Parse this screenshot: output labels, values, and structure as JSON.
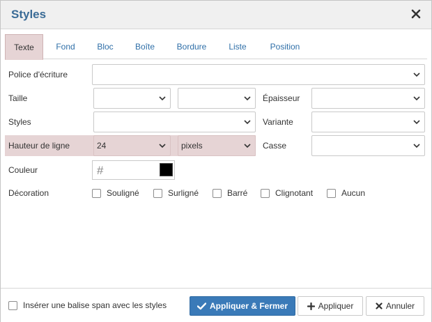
{
  "dialog": {
    "title": "Styles",
    "close_icon": "close-icon"
  },
  "tabs": [
    {
      "label": "Texte",
      "active": true
    },
    {
      "label": "Fond",
      "active": false
    },
    {
      "label": "Bloc",
      "active": false
    },
    {
      "label": "Boîte",
      "active": false
    },
    {
      "label": "Bordure",
      "active": false
    },
    {
      "label": "Liste",
      "active": false
    },
    {
      "label": "Position",
      "active": false
    }
  ],
  "form": {
    "font_label": "Police d'écriture",
    "font_value": "",
    "size_label": "Taille",
    "size_value": "",
    "size_unit": "",
    "weight_label": "Épaisseur",
    "weight_value": "",
    "styles_label": "Styles",
    "styles_value": "",
    "variant_label": "Variante",
    "variant_value": "",
    "line_height_label": "Hauteur de ligne",
    "line_height_value": "24",
    "line_height_unit": "pixels",
    "case_label": "Casse",
    "case_value": "",
    "color_label": "Couleur",
    "color_hash": "#",
    "color_swatch": "#000000",
    "decoration_label": "Décoration",
    "decorations": [
      "Souligné",
      "Surligné",
      "Barré",
      "Clignotant",
      "Aucun"
    ]
  },
  "footer": {
    "span_checkbox_label": "Insérer une balise span avec les styles",
    "apply_close_label": "Appliquer & Fermer",
    "apply_label": "Appliquer",
    "cancel_label": "Annuler"
  },
  "colors": {
    "accent": "#3a7ab8",
    "title": "#3a6b96",
    "highlight": "#e6d4d5",
    "link": "#2f6fa8"
  }
}
